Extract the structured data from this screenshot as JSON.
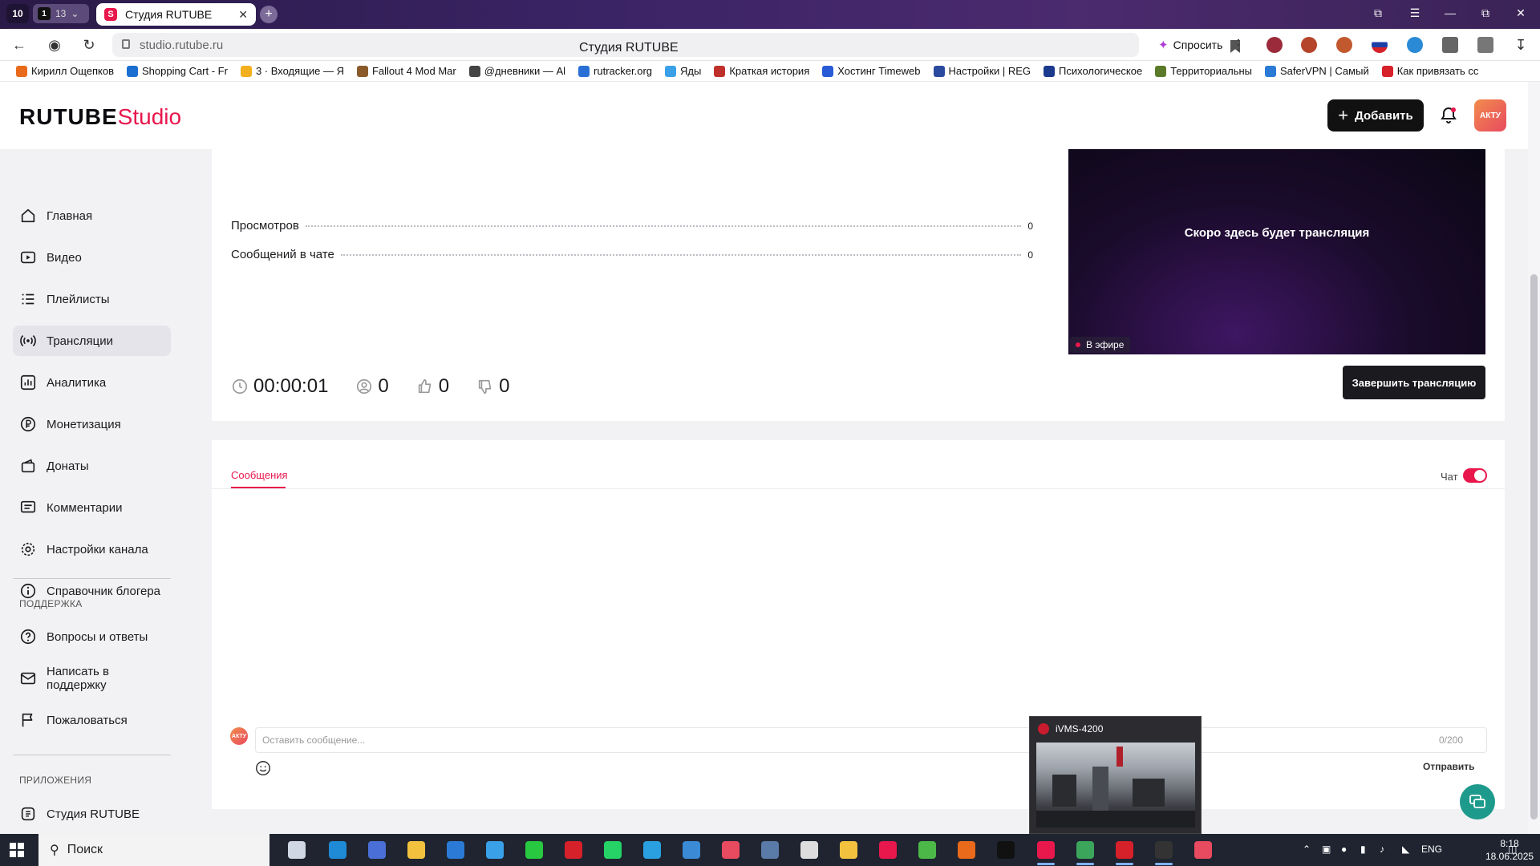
{
  "browser": {
    "tab_counter_left": "10",
    "tab_group_count": "13",
    "tab_group_badge": "1",
    "active_tab_title": "Студия RUTUBE",
    "url": "studio.rutube.ru",
    "page_title": "Студия RUTUBE",
    "ask_label": "Спросить",
    "bookmarks": [
      {
        "label": "Кирилл Ощепков",
        "color": "#e86a1a"
      },
      {
        "label": "Shopping Cart - Fr",
        "color": "#1b6fd1"
      },
      {
        "label": "3 · Входящие — Я",
        "color": "#f2b01e"
      },
      {
        "label": "Fallout 4 Mod Mar",
        "color": "#8a5a2b"
      },
      {
        "label": "@дневники — Al",
        "color": "#444444"
      },
      {
        "label": "rutracker.org",
        "color": "#2a6fd6"
      },
      {
        "label": "Яды",
        "color": "#3aa0e8"
      },
      {
        "label": "Краткая история",
        "color": "#c0302b"
      },
      {
        "label": "Хостинг Timeweb",
        "color": "#2a5bd6"
      },
      {
        "label": "Настройки | REG",
        "color": "#2a4a9e"
      },
      {
        "label": "Психологическое",
        "color": "#1b3a8e"
      },
      {
        "label": "Территориальны",
        "color": "#5a7a2a"
      },
      {
        "label": "SaferVPN | Самый",
        "color": "#2a7ad6"
      },
      {
        "label": "Как привязать сс",
        "color": "#d6202a"
      }
    ]
  },
  "header": {
    "logo_main": "RUTUBE",
    "logo_sub": "Studio",
    "add_label": "Добавить",
    "avatar_text": "АКТУ"
  },
  "sidebar": {
    "items": [
      {
        "label": "Главная",
        "icon": "home-icon"
      },
      {
        "label": "Видео",
        "icon": "video-icon"
      },
      {
        "label": "Плейлисты",
        "icon": "playlist-icon"
      },
      {
        "label": "Трансляции",
        "icon": "broadcast-icon"
      },
      {
        "label": "Аналитика",
        "icon": "analytics-icon"
      },
      {
        "label": "Монетизация",
        "icon": "ruble-icon"
      },
      {
        "label": "Донаты",
        "icon": "donate-icon"
      },
      {
        "label": "Комментарии",
        "icon": "comment-icon"
      },
      {
        "label": "Настройки канала",
        "icon": "gear-icon"
      },
      {
        "label": "Справочник блогера",
        "icon": "info-icon"
      }
    ],
    "support_heading": "ПОДДЕРЖКА",
    "support_items": [
      {
        "label": "Вопросы и ответы",
        "icon": "question-icon"
      },
      {
        "label": "Написать в поддержку",
        "icon": "mail-icon"
      },
      {
        "label": "Пожаловаться",
        "icon": "flag-icon"
      }
    ],
    "apps_heading": "ПРИЛОЖЕНИЯ",
    "apps_items": [
      {
        "label": "Студия RUTUBE",
        "icon": "studio-app-icon"
      }
    ]
  },
  "stream": {
    "stats": [
      {
        "label": "Просмотров",
        "value": "0"
      },
      {
        "label": "Сообщений в чате",
        "value": "0"
      }
    ],
    "preview_text": "Скоро здесь будет трансляция",
    "live_badge": "В эфире",
    "timer": "00:00:01",
    "viewers": "0",
    "likes": "0",
    "dislikes": "0",
    "finish_label": "Завершить трансляцию"
  },
  "chat": {
    "tab_label": "Сообщения",
    "toggle_label": "Чат",
    "toggle_on": true,
    "input_placeholder": "Оставить сообщение...",
    "char_count": "0/200",
    "send_label": "Отправить"
  },
  "thumbnail_popup": {
    "title": "iVMS-4200"
  },
  "taskbar": {
    "search_label": "Поиск",
    "language": "ENG",
    "time": "8:18",
    "date": "18.06.2025"
  },
  "colors": {
    "accent": "#e8174c",
    "dark_button": "#1b1b1f",
    "help_fab": "#1e9a8c"
  }
}
